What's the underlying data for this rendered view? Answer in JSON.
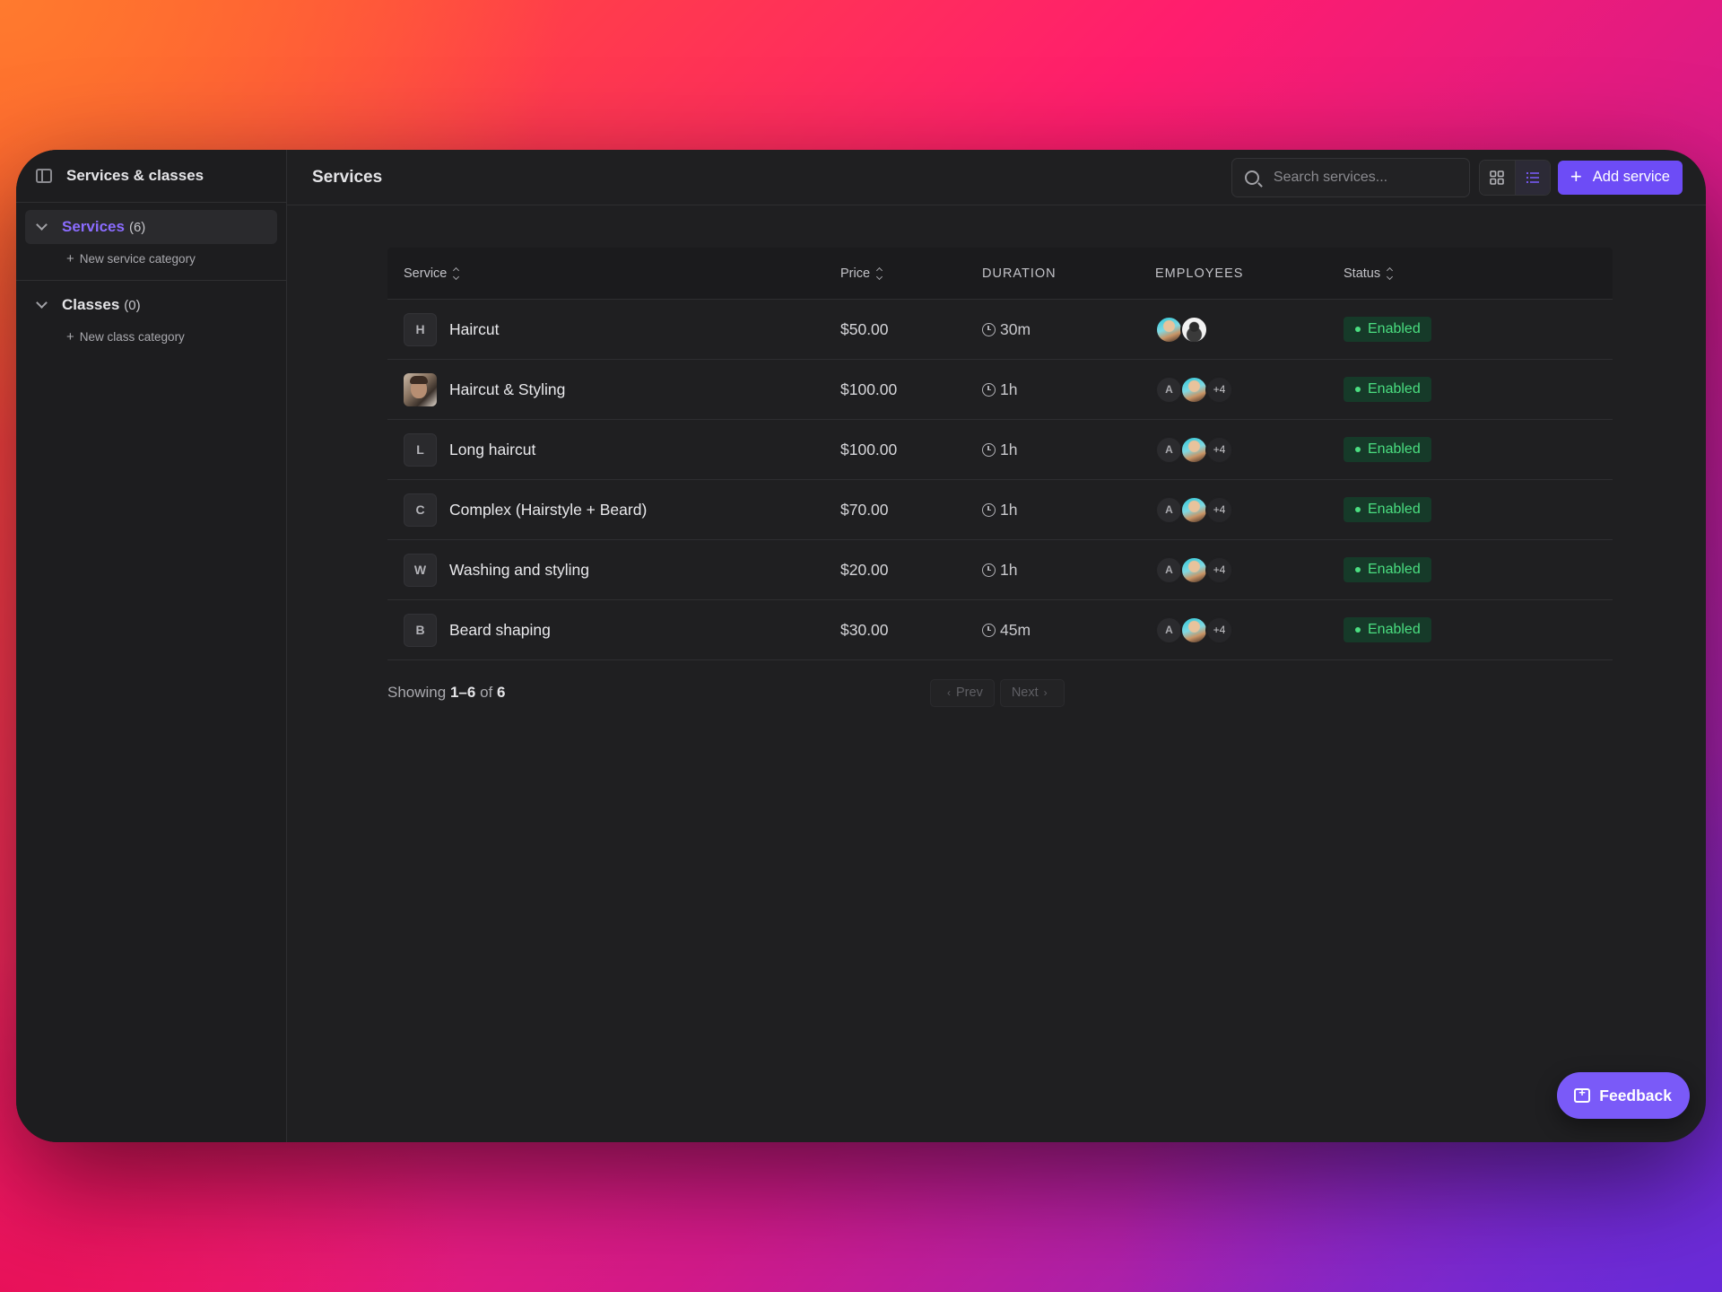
{
  "sidebar": {
    "title": "Services & classes",
    "groups": [
      {
        "label": "Services",
        "count": "(6)",
        "new_label": "New service category"
      },
      {
        "label": "Classes",
        "count": "(0)",
        "new_label": "New class category"
      }
    ]
  },
  "header": {
    "title": "Services",
    "search_placeholder": "Search services...",
    "add_label": "Add service",
    "active_view": "list"
  },
  "table": {
    "columns": {
      "service": "Service",
      "price": "Price",
      "duration": "DURATION",
      "employees": "EMPLOYEES",
      "status": "Status"
    },
    "rows": [
      {
        "initial": "H",
        "name": "Haircut",
        "price": "$50.00",
        "duration": "30m",
        "employees_extra": "",
        "status": "Enabled"
      },
      {
        "initial": "",
        "name": "Haircut & Styling",
        "price": "$100.00",
        "duration": "1h",
        "employee_initial": "A",
        "employees_extra": "+4",
        "status": "Enabled"
      },
      {
        "initial": "L",
        "name": "Long haircut",
        "price": "$100.00",
        "duration": "1h",
        "employee_initial": "A",
        "employees_extra": "+4",
        "status": "Enabled"
      },
      {
        "initial": "C",
        "name": "Complex (Hairstyle + Beard)",
        "price": "$70.00",
        "duration": "1h",
        "employee_initial": "A",
        "employees_extra": "+4",
        "status": "Enabled"
      },
      {
        "initial": "W",
        "name": "Washing and styling",
        "price": "$20.00",
        "duration": "1h",
        "employee_initial": "A",
        "employees_extra": "+4",
        "status": "Enabled"
      },
      {
        "initial": "B",
        "name": "Beard shaping",
        "price": "$30.00",
        "duration": "45m",
        "employee_initial": "A",
        "employees_extra": "+4",
        "status": "Enabled"
      }
    ]
  },
  "footer": {
    "showing_prefix": "Showing",
    "range": "1–6",
    "of": "of",
    "total": "6",
    "prev": "Prev",
    "next": "Next"
  },
  "feedback_label": "Feedback",
  "colors": {
    "accent": "#6d4cf6",
    "status_green": "#4ade80",
    "background": "#1f1f21"
  }
}
